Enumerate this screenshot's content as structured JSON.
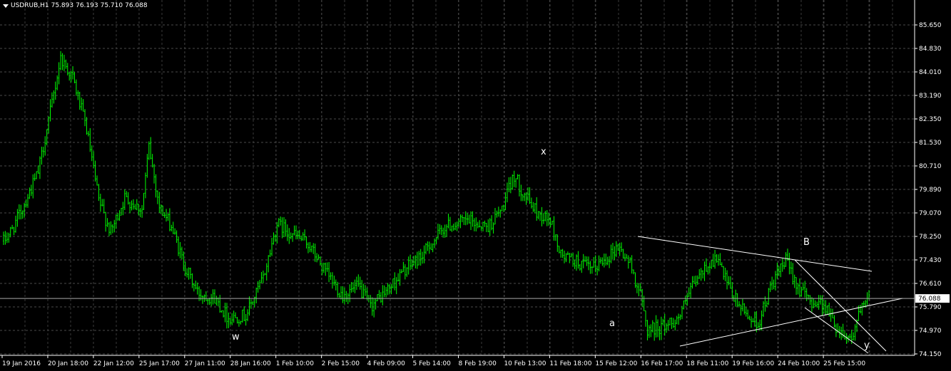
{
  "header": {
    "symbol": "USDRUB,H1",
    "open": "75.893",
    "high": "76.193",
    "low": "75.710",
    "close": "76.088"
  },
  "current_price_label": "76.088",
  "colors": {
    "background": "#000000",
    "grid": "#4a4a4a",
    "candle": "#00ff00",
    "axis": "#ffffff",
    "price_box": "#ffffff",
    "trendline": "#ffffff"
  },
  "icons": {
    "menu": "triangle-down-icon"
  },
  "chart_data": {
    "type": "candlestick",
    "y_ticks": [
      "85.650",
      "84.830",
      "84.010",
      "83.190",
      "82.350",
      "81.530",
      "80.710",
      "79.890",
      "79.070",
      "78.250",
      "77.430",
      "76.610",
      "75.790",
      "74.970",
      "74.150"
    ],
    "x_ticks": [
      "19 Jan 2016",
      "20 Jan 18:00",
      "22 Jan 12:00",
      "25 Jan 17:00",
      "27 Jan 11:00",
      "28 Jan 16:00",
      "1 Feb 10:00",
      "2 Feb 15:00",
      "4 Feb 09:00",
      "5 Feb 14:00",
      "8 Feb 19:00",
      "10 Feb 13:00",
      "11 Feb 18:00",
      "15 Feb 12:00",
      "16 Feb 17:00",
      "18 Feb 11:00",
      "19 Feb 16:00",
      "24 Feb 10:00",
      "25 Feb 15:00"
    ],
    "ylim": [
      74.15,
      85.65
    ],
    "current_price": 76.088,
    "grid": true,
    "wave_labels": [
      "w",
      "x",
      "a",
      "B",
      "y"
    ],
    "anchors": [
      {
        "bar": 0,
        "price": 78.1
      },
      {
        "bar": 5,
        "price": 78.5
      },
      {
        "bar": 12,
        "price": 79.4
      },
      {
        "bar": 20,
        "price": 80.5
      },
      {
        "bar": 27,
        "price": 82.6
      },
      {
        "bar": 33,
        "price": 84.5
      },
      {
        "bar": 40,
        "price": 83.8
      },
      {
        "bar": 48,
        "price": 82.0
      },
      {
        "bar": 55,
        "price": 79.5
      },
      {
        "bar": 62,
        "price": 78.4
      },
      {
        "bar": 70,
        "price": 79.6
      },
      {
        "bar": 80,
        "price": 79.2
      },
      {
        "bar": 84,
        "price": 81.4
      },
      {
        "bar": 90,
        "price": 79.3
      },
      {
        "bar": 97,
        "price": 78.6
      },
      {
        "bar": 104,
        "price": 77.3
      },
      {
        "bar": 112,
        "price": 76.3
      },
      {
        "bar": 122,
        "price": 76.1
      },
      {
        "bar": 130,
        "price": 75.4
      },
      {
        "bar": 140,
        "price": 75.5
      },
      {
        "bar": 150,
        "price": 76.8
      },
      {
        "bar": 158,
        "price": 78.7
      },
      {
        "bar": 168,
        "price": 78.3
      },
      {
        "bar": 176,
        "price": 78.0
      },
      {
        "bar": 186,
        "price": 77.0
      },
      {
        "bar": 196,
        "price": 76.2
      },
      {
        "bar": 205,
        "price": 76.5
      },
      {
        "bar": 212,
        "price": 75.8
      },
      {
        "bar": 222,
        "price": 76.4
      },
      {
        "bar": 232,
        "price": 77.1
      },
      {
        "bar": 242,
        "price": 77.6
      },
      {
        "bar": 255,
        "price": 78.6
      },
      {
        "bar": 268,
        "price": 78.8
      },
      {
        "bar": 280,
        "price": 78.6
      },
      {
        "bar": 288,
        "price": 79.2
      },
      {
        "bar": 295,
        "price": 80.4
      },
      {
        "bar": 300,
        "price": 79.8
      },
      {
        "bar": 308,
        "price": 79.1
      },
      {
        "bar": 316,
        "price": 78.8
      },
      {
        "bar": 322,
        "price": 77.6
      },
      {
        "bar": 330,
        "price": 77.4
      },
      {
        "bar": 340,
        "price": 77.1
      },
      {
        "bar": 350,
        "price": 77.6
      },
      {
        "bar": 355,
        "price": 77.9
      },
      {
        "bar": 362,
        "price": 77.3
      },
      {
        "bar": 368,
        "price": 76.2
      },
      {
        "bar": 372,
        "price": 75.0
      },
      {
        "bar": 380,
        "price": 75.1
      },
      {
        "bar": 390,
        "price": 75.4
      },
      {
        "bar": 398,
        "price": 76.5
      },
      {
        "bar": 406,
        "price": 77.2
      },
      {
        "bar": 412,
        "price": 77.5
      },
      {
        "bar": 420,
        "price": 76.3
      },
      {
        "bar": 428,
        "price": 75.6
      },
      {
        "bar": 436,
        "price": 75.2
      },
      {
        "bar": 444,
        "price": 76.6
      },
      {
        "bar": 452,
        "price": 77.4
      },
      {
        "bar": 460,
        "price": 76.4
      },
      {
        "bar": 466,
        "price": 76.0
      },
      {
        "bar": 474,
        "price": 75.9
      },
      {
        "bar": 482,
        "price": 75.0
      },
      {
        "bar": 490,
        "price": 74.7
      },
      {
        "bar": 494,
        "price": 75.5
      },
      {
        "bar": 500,
        "price": 76.1
      }
    ]
  }
}
